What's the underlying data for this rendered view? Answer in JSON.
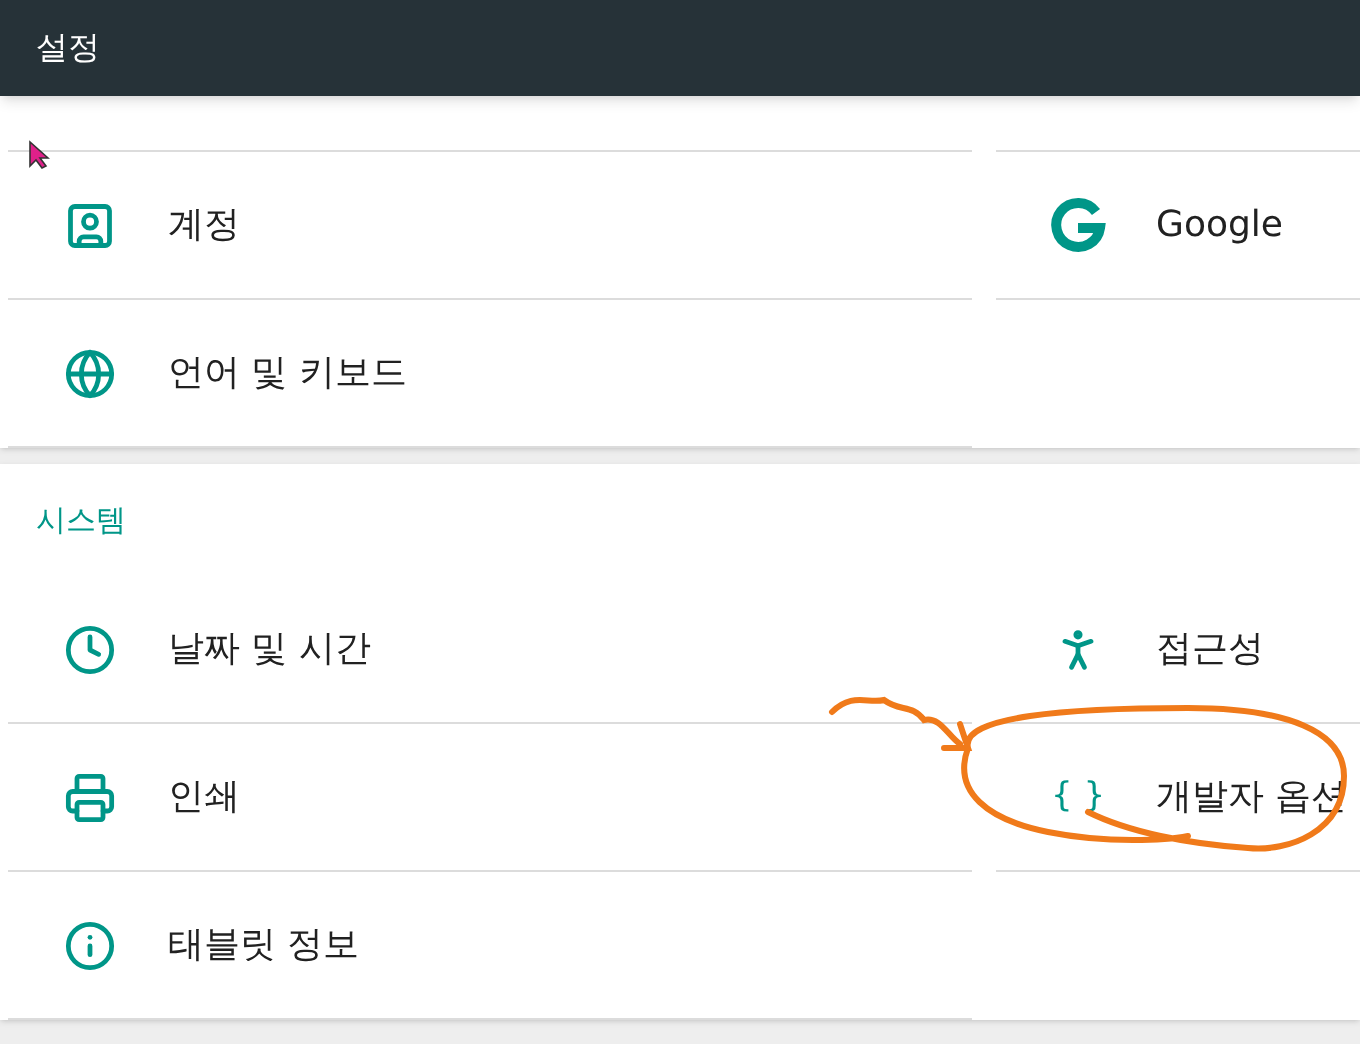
{
  "app_bar": {
    "title": "설정"
  },
  "sections": [
    {
      "rows": [
        {
          "left": {
            "label": "계정"
          },
          "right": {
            "label": "Google"
          }
        },
        {
          "left": {
            "label": "언어 및 키보드"
          }
        }
      ]
    },
    {
      "title": "시스템",
      "rows": [
        {
          "left": {
            "label": "날짜 및 시간"
          },
          "right": {
            "label": "접근성"
          }
        },
        {
          "left": {
            "label": "인쇄"
          },
          "right": {
            "label": "개발자 옵션",
            "glyph": "{ }"
          }
        },
        {
          "left": {
            "label": "태블릿 정보"
          }
        }
      ]
    }
  ]
}
